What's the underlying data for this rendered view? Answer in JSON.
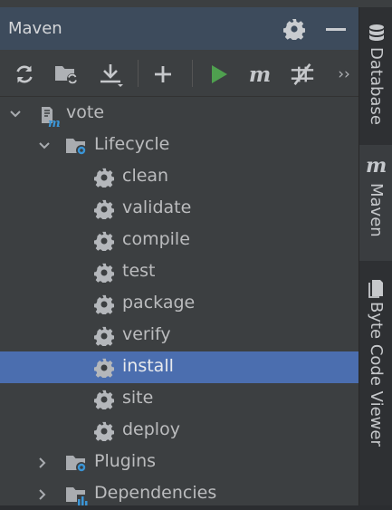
{
  "panel": {
    "title": "Maven",
    "header_icons": [
      "gear-icon",
      "minimize-icon"
    ]
  },
  "toolbar": {
    "icons": [
      "reload-icon",
      "reimport-folder-icon",
      "download-icon",
      "add-icon",
      "run-icon",
      "execute-goal-icon",
      "skip-tests-icon",
      "more-chevron-icon"
    ],
    "m_glyph": "m",
    "more_glyph": "››"
  },
  "tree": {
    "root": "vote",
    "lifecycle": "Lifecycle",
    "goals": [
      "clean",
      "validate",
      "compile",
      "test",
      "package",
      "verify",
      "install",
      "site",
      "deploy"
    ],
    "selected_goal": "install",
    "plugins": "Plugins",
    "dependencies": "Dependencies"
  },
  "sidebar": {
    "tabs": [
      "Database",
      "Maven",
      "Byte Code Viewer"
    ],
    "active": "Maven",
    "maven_glyph": "m"
  },
  "colors": {
    "header_bg": "#3d4b5c",
    "panel_bg": "#3c3f41",
    "selection": "#4b6eaf",
    "run_green": "#4fa04f",
    "icon_blue": "#3a95d6"
  }
}
